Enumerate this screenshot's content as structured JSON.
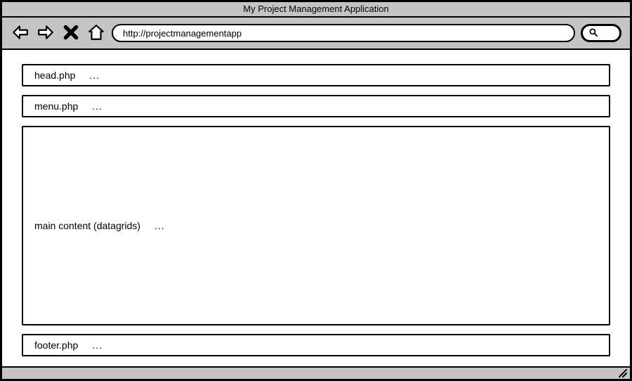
{
  "window": {
    "title": "My Project Management Application"
  },
  "toolbar": {
    "url": "http://projectmanagementapp"
  },
  "panels": {
    "head": {
      "label": "head.php",
      "ellipsis": "..."
    },
    "menu": {
      "label": "menu.php",
      "ellipsis": "..."
    },
    "main": {
      "label": "main content (datagrids)",
      "ellipsis": "..."
    },
    "footer": {
      "label": "footer.php",
      "ellipsis": "..."
    }
  }
}
